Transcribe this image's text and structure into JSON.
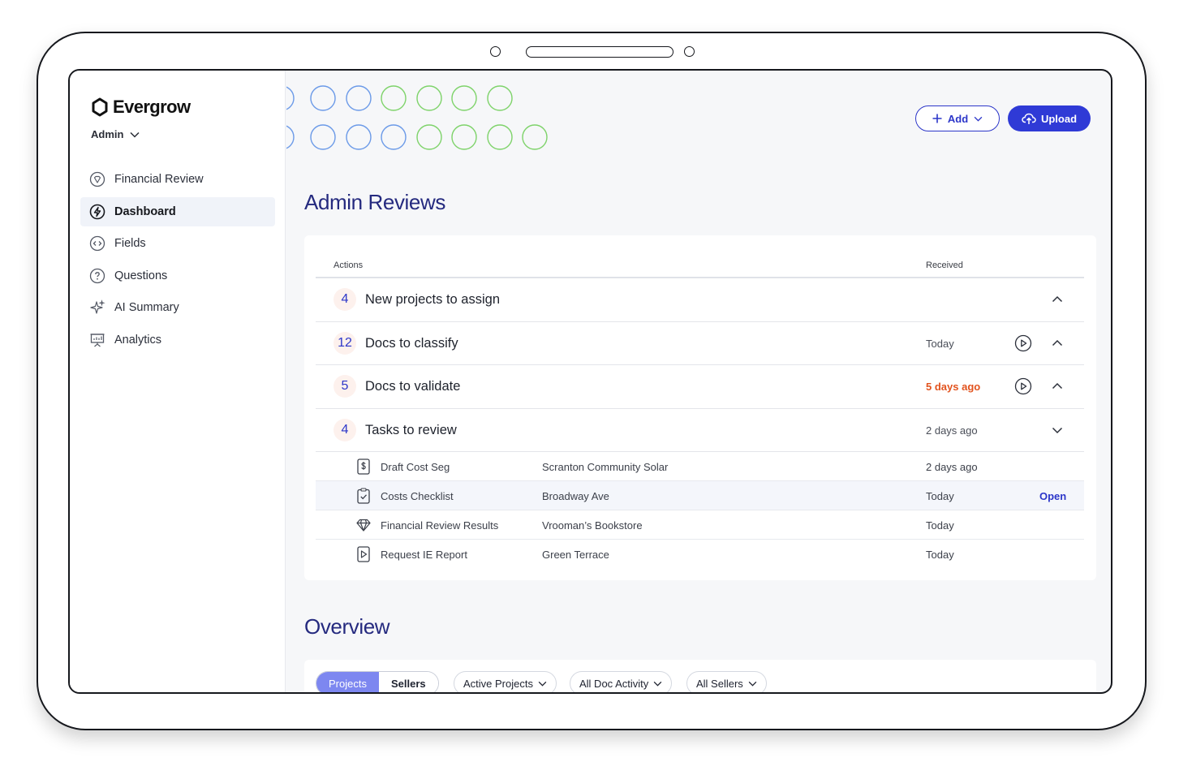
{
  "brand": {
    "name": "Evergrow"
  },
  "role_selector": {
    "label": "Admin"
  },
  "sidebar": {
    "items": [
      {
        "label": "Financial Review",
        "icon": "shield-heart-icon",
        "active": false
      },
      {
        "label": "Dashboard",
        "icon": "lightning-icon",
        "active": true
      },
      {
        "label": "Fields",
        "icon": "code-circle-icon",
        "active": false
      },
      {
        "label": "Questions",
        "icon": "question-circle-icon",
        "active": false
      },
      {
        "label": "AI Summary",
        "icon": "sparkles-icon",
        "active": false
      },
      {
        "label": "Analytics",
        "icon": "presentation-chart-icon",
        "active": false
      }
    ]
  },
  "toolbar": {
    "add_label": "Add",
    "upload_label": "Upload"
  },
  "colors": {
    "accent": "#2c36c9",
    "title": "#252a7f",
    "alert": "#e2531e",
    "decor_blue": "#6b9ae8",
    "decor_green": "#7ed36a"
  },
  "reviews": {
    "title": "Admin Reviews",
    "columns": {
      "actions": "Actions",
      "received": "Received"
    },
    "groups": [
      {
        "count": "4",
        "label": "New projects to assign",
        "received": "",
        "alert": false,
        "play": false,
        "expanded": true
      },
      {
        "count": "12",
        "label": "Docs to classify",
        "received": "Today",
        "alert": false,
        "play": true,
        "expanded": true
      },
      {
        "count": "5",
        "label": "Docs to validate",
        "received": "5 days ago",
        "alert": true,
        "play": true,
        "expanded": true
      },
      {
        "count": "4",
        "label": "Tasks to review",
        "received": "2 days ago",
        "alert": false,
        "play": false,
        "expanded": false
      }
    ],
    "tasks": [
      {
        "icon": "dollar-doc-icon",
        "name": "Draft Cost Seg",
        "project": "Scranton Community Solar",
        "received": "2 days ago",
        "action": ""
      },
      {
        "icon": "clipboard-check-icon",
        "name": "Costs Checklist",
        "project": "Broadway Ave",
        "received": "Today",
        "action": "Open"
      },
      {
        "icon": "diamond-icon",
        "name": "Financial Review Results",
        "project": "Vrooman’s Bookstore",
        "received": "Today",
        "action": ""
      },
      {
        "icon": "play-doc-icon",
        "name": "Request IE Report",
        "project": "Green Terrace",
        "received": "Today",
        "action": ""
      }
    ]
  },
  "overview": {
    "title": "Overview",
    "segments": [
      "Projects",
      "Sellers"
    ],
    "active_segment": "Projects",
    "filters": [
      "Active Projects",
      "All Doc Activity",
      "All Sellers"
    ]
  }
}
